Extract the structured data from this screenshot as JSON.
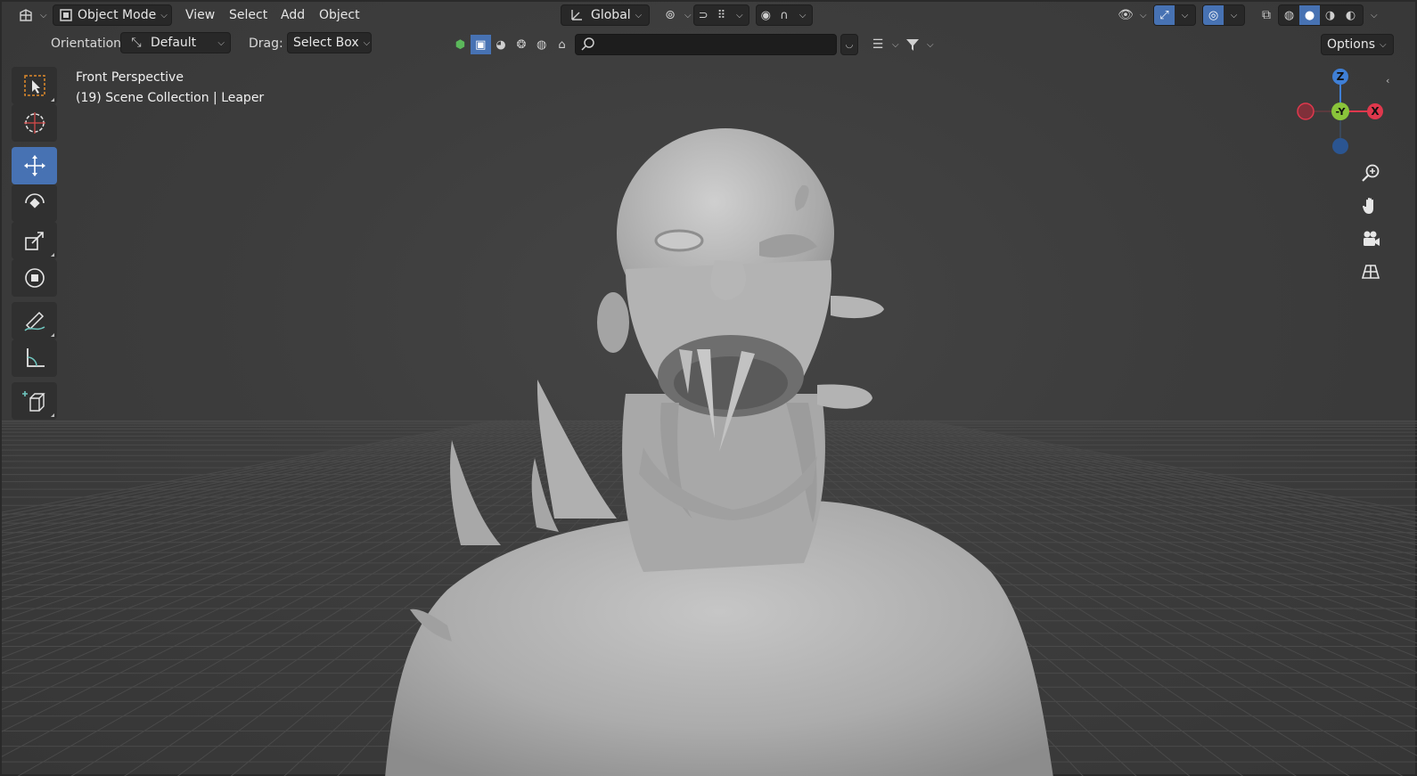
{
  "header": {
    "editor_type_icon": "editor-type-icon",
    "mode": {
      "label": "Object Mode"
    },
    "menus": [
      {
        "label": "View"
      },
      {
        "label": "Select"
      },
      {
        "label": "Add"
      },
      {
        "label": "Object"
      }
    ],
    "transform_orientation": "Global",
    "right_icons": [
      "visibility-icon",
      "gizmo-icon",
      "overlay-icon",
      "xray-icon",
      "wireframe-shading-icon",
      "solid-shading-icon",
      "material-shading-icon",
      "rendered-shading-icon"
    ]
  },
  "tool_header": {
    "orientation_label": "Orientation:",
    "orientation_value": "Default",
    "drag_label": "Drag:",
    "drag_value": "Select Box",
    "options_label": "Options",
    "search_placeholder": ""
  },
  "viewport": {
    "view_name": "Front Perspective",
    "collection_line": "(19) Scene Collection | Leaper"
  },
  "toolbar": [
    {
      "name": "select-box-tool",
      "icon": "select-box-icon",
      "active": false
    },
    {
      "name": "cursor-tool",
      "icon": "cursor-icon",
      "active": false
    },
    {
      "name": "move-tool",
      "icon": "move-icon",
      "active": true
    },
    {
      "name": "rotate-tool",
      "icon": "rotate-icon",
      "active": false
    },
    {
      "name": "scale-tool",
      "icon": "scale-icon",
      "active": false
    },
    {
      "name": "transform-tool",
      "icon": "transform-icon",
      "active": false
    },
    {
      "name": "annotate-tool",
      "icon": "annotate-icon",
      "active": false
    },
    {
      "name": "measure-tool",
      "icon": "measure-icon",
      "active": false
    },
    {
      "name": "add-cube-tool",
      "icon": "add-cube-icon",
      "active": false
    }
  ],
  "nav_gizmo": {
    "axis_z": "Z",
    "axis_y": "-Y",
    "axis_x": "X",
    "colors": {
      "x": "#e0384d",
      "y": "#8ac43a",
      "z": "#3f7fd6"
    }
  },
  "nav_buttons": [
    "zoom-icon",
    "pan-hand-icon",
    "camera-icon",
    "ortho-grid-icon"
  ],
  "colors": {
    "accent": "#4772b3",
    "viewport_bg": "#3d3d3d",
    "model": "#b8b8b8"
  }
}
